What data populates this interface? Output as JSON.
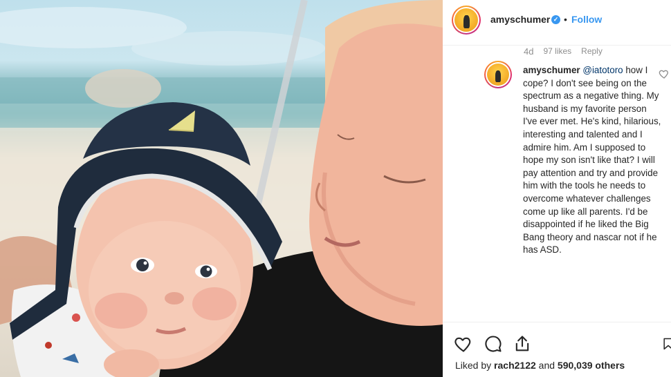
{
  "post": {
    "username": "amyschumer",
    "verified_mark": "✓",
    "separator": "•",
    "follow_label": "Follow"
  },
  "comment_meta": {
    "time": "4d",
    "likes": "97 likes",
    "reply_label": "Reply"
  },
  "comment": {
    "username": "amyschumer",
    "mention": "@iatotoro",
    "text": "how I cope? I don't see being on the spectrum as a negative thing. My husband is my favorite person I've ever met. He's kind, hilarious, interesting and talented and I admire him. Am I supposed to hope my son isn't like that? I will pay attention and try and provide him with the tools he needs to overcome whatever challenges come up like all parents. I'd be disappointed if he liked the Big Bang theory and nascar not if he has ASD."
  },
  "likes_line": {
    "prefix": "Liked by",
    "user": "rach2122",
    "middle": "and",
    "count": "590,039 others"
  },
  "icons": [
    "heart-icon",
    "comment-icon",
    "share-icon",
    "bookmark-icon",
    "verified-icon",
    "like-comment-icon"
  ],
  "colors": {
    "link_blue": "#3897f0",
    "mention_blue": "#003569",
    "muted_gray": "#8e8e8e",
    "text": "#262626"
  }
}
